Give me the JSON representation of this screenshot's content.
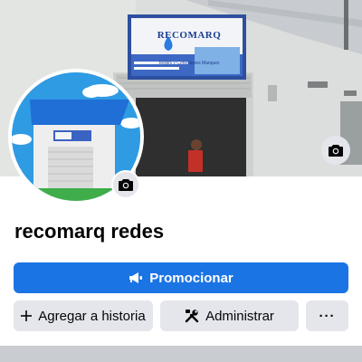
{
  "profile": {
    "name": "recomarq redes"
  },
  "cover": {
    "sign_brand": "RECOMARQ",
    "sign_subtitle": "Redes y Conexiones Marquez"
  },
  "actions": {
    "promote_label": "Promocionar",
    "add_story_label": "Agregar a historia",
    "manage_label": "Administrar",
    "more_label": "···"
  },
  "icons": {
    "cover_camera": "camera-icon",
    "avatar_camera": "camera-icon",
    "promote": "megaphone-icon",
    "add_story": "plus-icon",
    "manage": "tools-icon"
  },
  "colors": {
    "primary": "#1b74e4",
    "secondary": "#e4e6eb",
    "text": "#050505",
    "divider": "#c9ccd1"
  }
}
